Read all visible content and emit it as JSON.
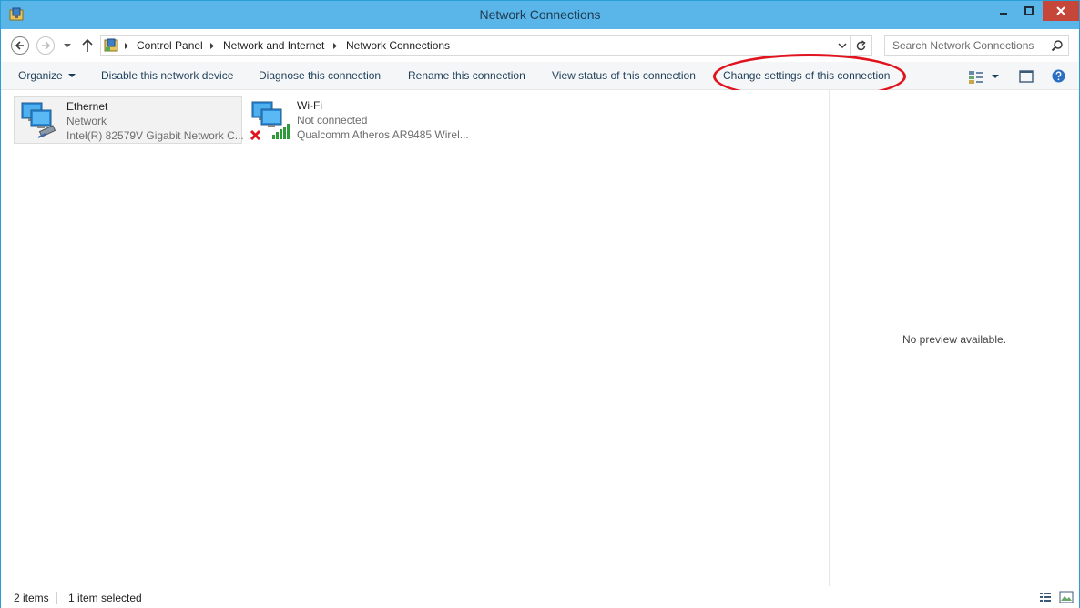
{
  "window": {
    "title": "Network Connections"
  },
  "nav": {
    "breadcrumb": [
      "Control Panel",
      "Network and Internet",
      "Network Connections"
    ],
    "search_placeholder": "Search Network Connections"
  },
  "commands": {
    "organize": "Organize",
    "disable": "Disable this network device",
    "diagnose": "Diagnose this connection",
    "rename": "Rename this connection",
    "view_status": "View status of this connection",
    "change_settings": "Change settings of this connection"
  },
  "connections": [
    {
      "name": "Ethernet",
      "status": "Network",
      "device": "Intel(R) 82579V Gigabit Network C...",
      "selected": true,
      "icon": "ethernet-adapter-icon"
    },
    {
      "name": "Wi-Fi",
      "status": "Not connected",
      "device": "Qualcomm Atheros AR9485 Wirel...",
      "selected": false,
      "icon": "wifi-adapter-icon"
    }
  ],
  "preview": {
    "message": "No preview available."
  },
  "statusbar": {
    "item_count": "2 items",
    "selection": "1 item selected"
  },
  "colors": {
    "titlebar": "#5ab6e8",
    "close_button": "#c7463a",
    "highlight_ring": "#e0141e",
    "command_text": "#1e3f5a"
  }
}
